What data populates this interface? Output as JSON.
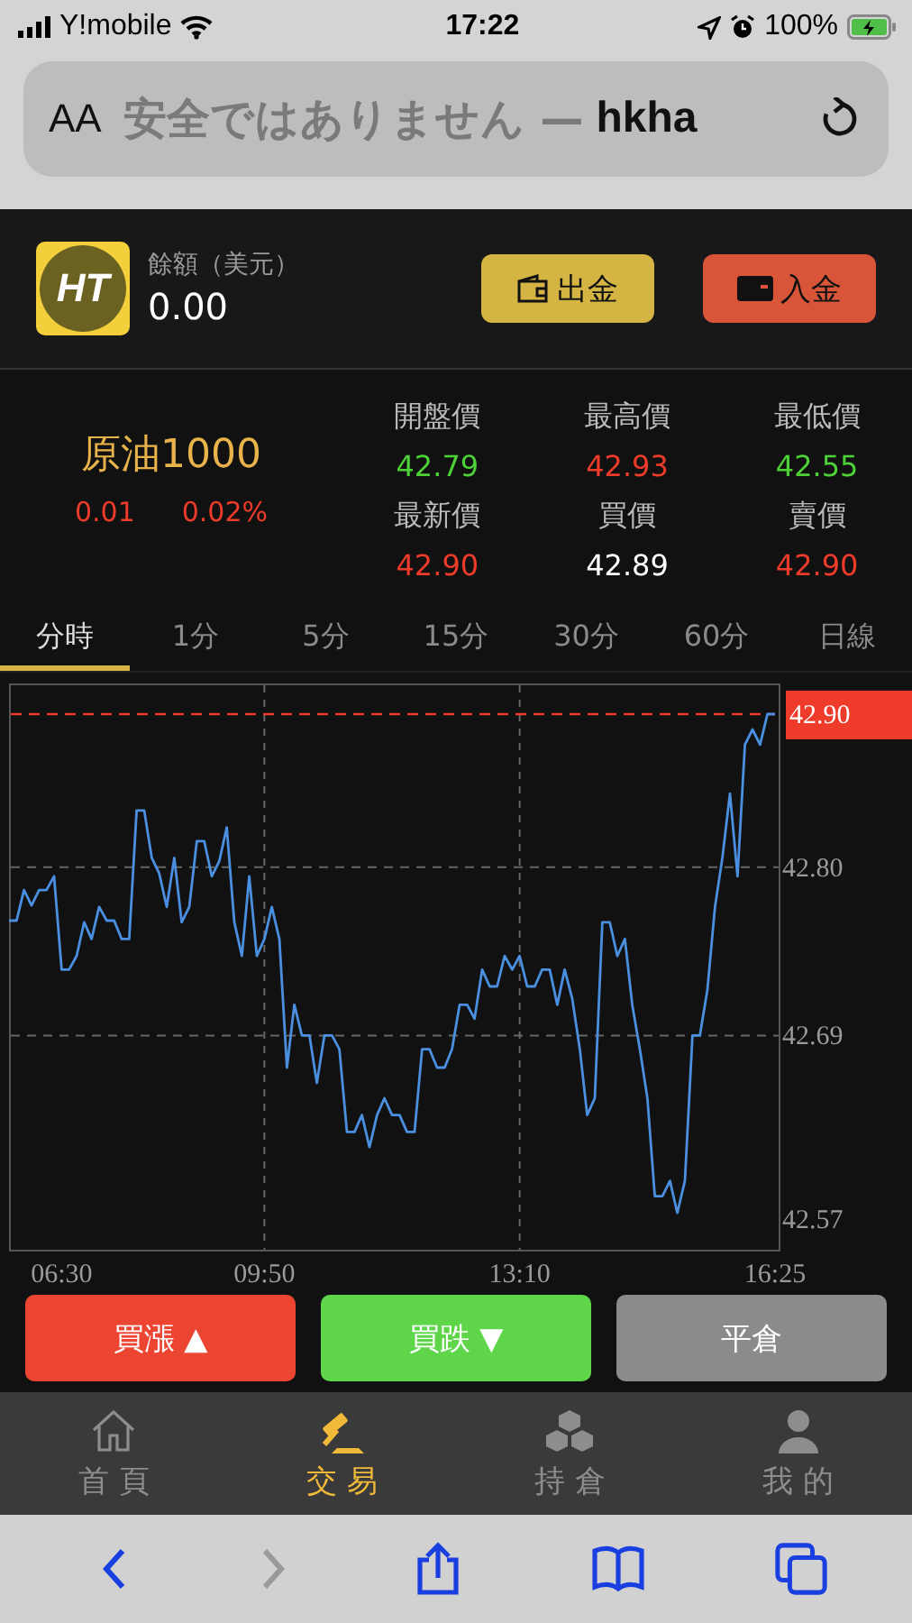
{
  "status_bar": {
    "carrier": "Y!mobile",
    "time": "17:22",
    "battery": "100%"
  },
  "address_bar": {
    "text_size": "AA",
    "warning": "安全ではありません —",
    "domain": "hkha"
  },
  "account": {
    "brand_mark": "HT",
    "label": "餘額（美元）",
    "balance": "0.00",
    "buttons": [
      {
        "kind": "withdraw",
        "label": "出金"
      },
      {
        "kind": "deposit",
        "label": "入金"
      }
    ]
  },
  "quote": {
    "name": "原油1000",
    "change": "0.01",
    "change_pct": "0.02%",
    "stats": [
      {
        "label": "開盤價",
        "value": "42.79",
        "color": "#4cd137"
      },
      {
        "label": "最高價",
        "value": "42.93",
        "color": "#ee3b2a"
      },
      {
        "label": "最低價",
        "value": "42.55",
        "color": "#4cd137"
      },
      {
        "label": "最新價",
        "value": "42.90",
        "color": "#ee3b2a"
      },
      {
        "label": "買價",
        "value": "42.89",
        "color": "#ffffff"
      },
      {
        "label": "賣價",
        "value": "42.90",
        "color": "#ee3b2a"
      }
    ]
  },
  "periods": [
    {
      "label": "分時",
      "selected": true
    },
    {
      "label": "1分",
      "selected": false
    },
    {
      "label": "5分",
      "selected": false
    },
    {
      "label": "15分",
      "selected": false
    },
    {
      "label": "30分",
      "selected": false
    },
    {
      "label": "60分",
      "selected": false
    },
    {
      "label": "日線",
      "selected": false
    }
  ],
  "chart_data": {
    "type": "line",
    "grid": true,
    "categories": [
      null,
      null,
      null,
      null,
      null,
      null,
      null,
      "06:30",
      null,
      null,
      null,
      null,
      null,
      null,
      null,
      null,
      null,
      null,
      null,
      null,
      null,
      null,
      null,
      null,
      null,
      null,
      null,
      null,
      null,
      null,
      null,
      null,
      null,
      null,
      "09:50",
      null,
      null,
      null,
      null,
      null,
      null,
      null,
      null,
      null,
      null,
      null,
      null,
      null,
      null,
      null,
      null,
      null,
      null,
      null,
      null,
      null,
      null,
      null,
      null,
      null,
      null,
      null,
      null,
      null,
      null,
      null,
      null,
      null,
      "13:10",
      null,
      null,
      null,
      null,
      null,
      null,
      null,
      null,
      null,
      null,
      null,
      null,
      null,
      null,
      null,
      null,
      null,
      null,
      null,
      null,
      null,
      null,
      null,
      null,
      null,
      null,
      null,
      null,
      null,
      null,
      null,
      null,
      null,
      "16:25"
    ],
    "ylim": [
      42.55,
      42.92
    ],
    "yticks": [
      {
        "value": 42.57,
        "label": "42.57"
      },
      {
        "value": 42.69,
        "label": "42.69"
      },
      {
        "value": 42.8,
        "label": "42.80"
      },
      {
        "value": 42.9,
        "label": "42.90"
      }
    ],
    "series": [
      {
        "color": "#4a8fe0",
        "values": [
          42.765,
          42.765,
          42.785,
          42.775,
          42.785,
          42.785,
          42.794,
          42.733,
          42.733,
          42.742,
          42.764,
          42.753,
          42.774,
          42.765,
          42.765,
          42.753,
          42.753,
          42.837,
          42.837,
          42.806,
          42.796,
          42.774,
          42.806,
          42.764,
          42.774,
          42.817,
          42.817,
          42.794,
          42.804,
          42.826,
          42.764,
          42.742,
          42.794,
          42.742,
          42.753,
          42.774,
          42.753,
          42.669,
          42.71,
          42.69,
          42.69,
          42.659,
          42.69,
          42.69,
          42.681,
          42.627,
          42.627,
          42.638,
          42.617,
          42.638,
          42.649,
          42.638,
          42.638,
          42.627,
          42.627,
          42.681,
          42.681,
          42.669,
          42.669,
          42.681,
          42.71,
          42.71,
          42.701,
          42.733,
          42.722,
          42.722,
          42.742,
          42.733,
          42.742,
          42.722,
          42.722,
          42.733,
          42.733,
          42.71,
          42.733,
          42.714,
          42.681,
          42.638,
          42.649,
          42.764,
          42.764,
          42.742,
          42.753,
          42.71,
          42.681,
          42.649,
          42.585,
          42.585,
          42.595,
          42.574,
          42.595,
          42.69,
          42.69,
          42.72,
          42.774,
          42.806,
          42.848,
          42.794,
          42.88,
          42.89,
          42.88,
          42.9,
          42.9
        ]
      }
    ],
    "ref_lines": [
      {
        "axis": "y",
        "value": 42.9,
        "color": "#ee3b2a"
      }
    ]
  },
  "trade_buttons": [
    {
      "kind": "buy_up",
      "label": "買漲 ▲"
    },
    {
      "kind": "buy_down",
      "label": "買跌 ▼"
    },
    {
      "kind": "close",
      "label": "平倉"
    }
  ],
  "nav": [
    {
      "kind": "home",
      "label": "首 頁",
      "selected": false
    },
    {
      "kind": "trade",
      "label": "交 易",
      "selected": true
    },
    {
      "kind": "holdings",
      "label": "持 倉",
      "selected": false
    },
    {
      "kind": "me",
      "label": "我 的",
      "selected": false
    }
  ],
  "browser_toolbar": [
    {
      "kind": "back",
      "disabled": false
    },
    {
      "kind": "forward",
      "disabled": true
    },
    {
      "kind": "share",
      "disabled": false
    },
    {
      "kind": "bookmarks",
      "disabled": false
    },
    {
      "kind": "tabs",
      "disabled": false
    }
  ]
}
